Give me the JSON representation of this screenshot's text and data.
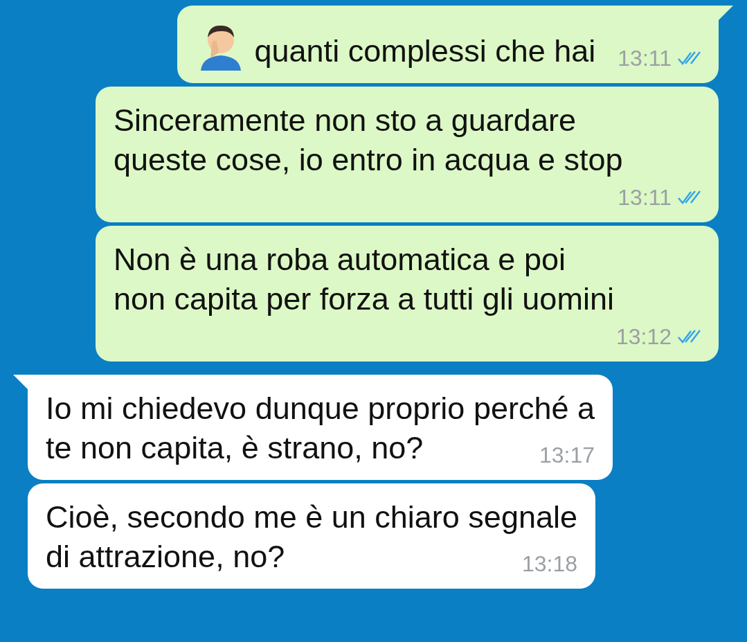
{
  "messages": [
    {
      "outgoing": true,
      "kind": "emoji_text",
      "tail": true,
      "lines": [
        "quanti complessi che hai"
      ],
      "time": "13:11",
      "read": true
    },
    {
      "outgoing": true,
      "kind": "text",
      "tail": false,
      "lines": [
        "Sinceramente non sto a guardare",
        "queste cose, io entro in acqua e stop"
      ],
      "time": "13:11",
      "read": true
    },
    {
      "outgoing": true,
      "kind": "text",
      "tail": false,
      "lines": [
        "Non è una roba automatica e poi",
        "non capita per forza a tutti gli uomini"
      ],
      "time": "13:12",
      "read": true
    },
    {
      "outgoing": false,
      "kind": "text",
      "tail": true,
      "lines": [
        "Io mi chiedevo dunque proprio perché a",
        "te non capita, è strano, no?"
      ],
      "time": "13:17"
    },
    {
      "outgoing": false,
      "kind": "text",
      "tail": false,
      "lines": [
        "Cioè, secondo me è un chiaro segnale",
        "di attrazione, no?"
      ],
      "time": "13:18"
    }
  ]
}
